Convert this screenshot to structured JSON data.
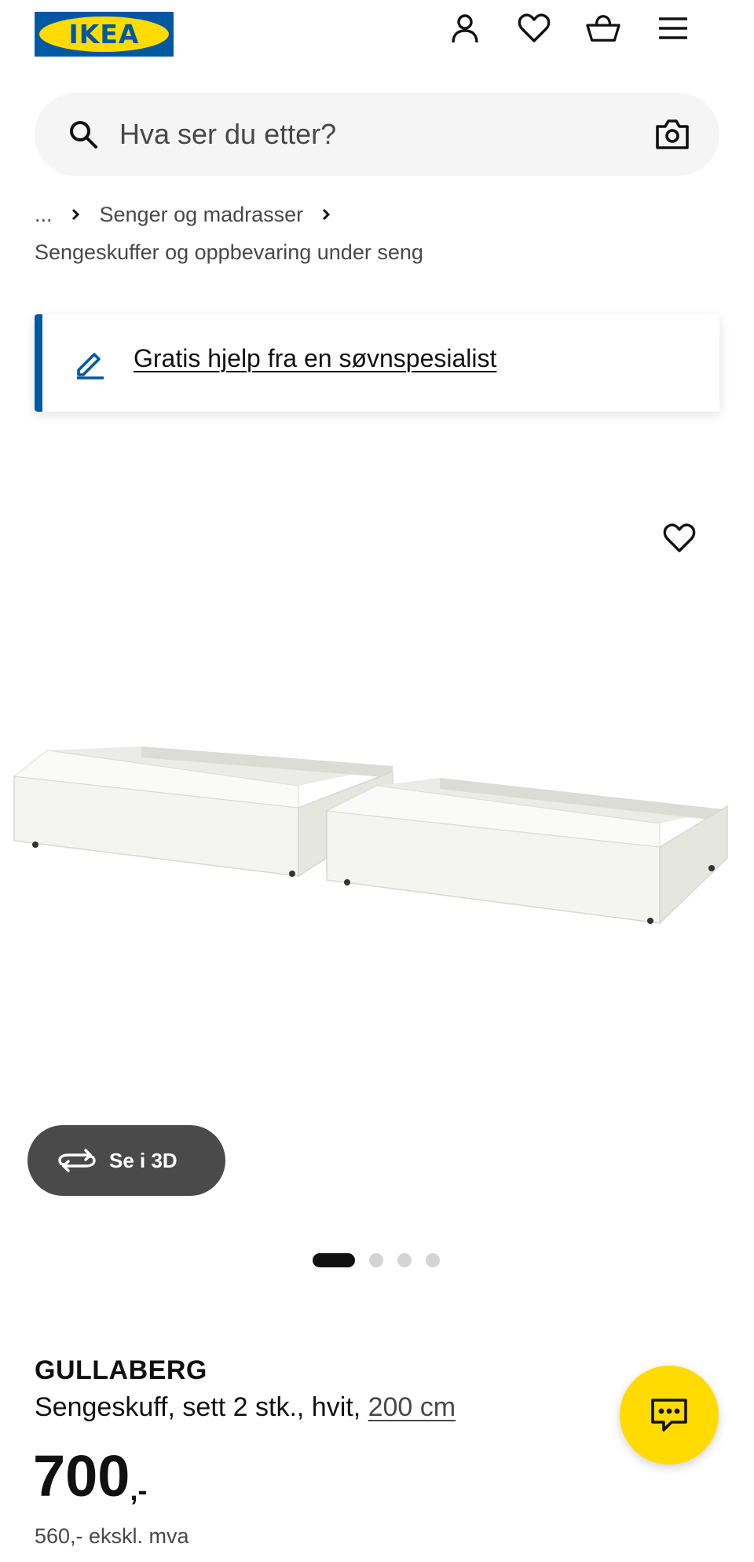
{
  "header": {
    "logo_text": "IKEA",
    "icons": [
      "profile-icon",
      "heart-icon",
      "cart-icon",
      "menu-icon"
    ]
  },
  "search": {
    "placeholder": "Hva ser du etter?"
  },
  "breadcrumb": {
    "ellipsis": "...",
    "level1": "Senger og madrasser",
    "category": "Sengeskuffer og oppbevaring under seng"
  },
  "help_banner": {
    "link_text": "Gratis hjelp fra en søvnspesialist"
  },
  "gallery": {
    "see_3d_label": "Se i 3D",
    "slide_count": 4,
    "active_slide": 1
  },
  "product": {
    "name": "GULLABERG",
    "description": "Sengeskuff, sett 2 stk., hvit, ",
    "size_link": "200 cm",
    "price_integer": "700",
    "price_suffix": ",-",
    "price_excl_vat": "560,- ekskl. mva"
  },
  "colors": {
    "ikea_blue": "#0058a3",
    "ikea_yellow": "#ffdb00",
    "text": "#111111",
    "text_secondary": "#484848"
  }
}
